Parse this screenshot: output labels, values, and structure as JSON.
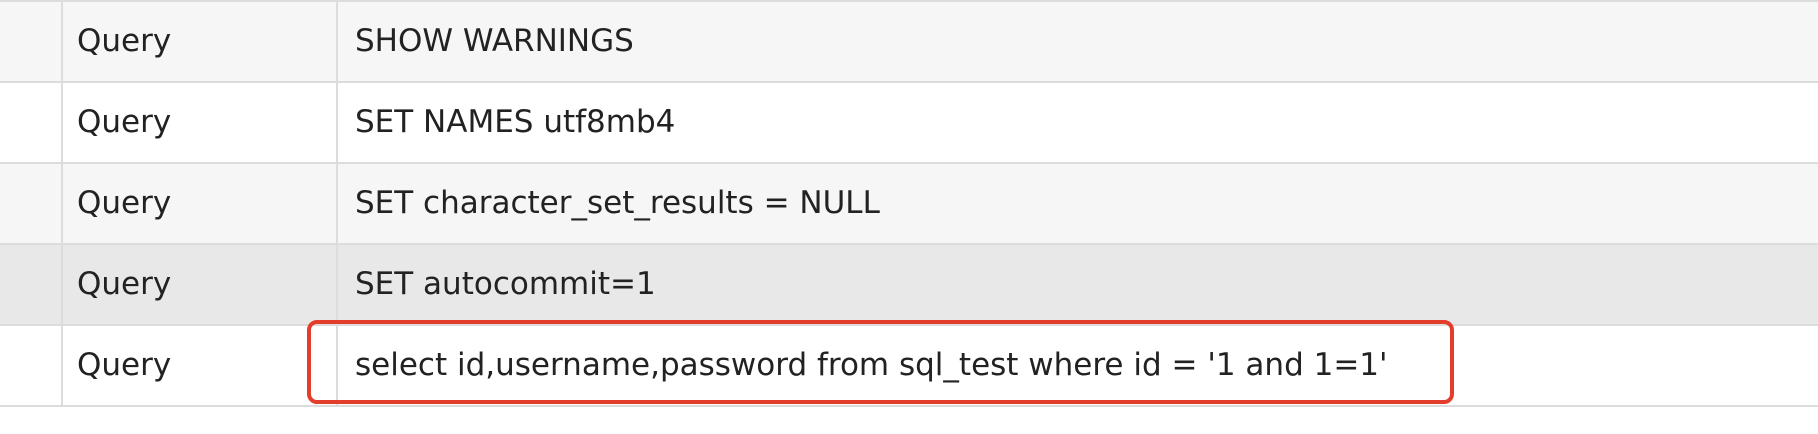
{
  "rows": [
    {
      "command_type": "Query",
      "argument": "SHOW WARNINGS",
      "selected": false
    },
    {
      "command_type": "Query",
      "argument": "SET NAMES utf8mb4",
      "selected": false
    },
    {
      "command_type": "Query",
      "argument": "SET character_set_results = NULL",
      "selected": false
    },
    {
      "command_type": "Query",
      "argument": "SET autocommit=1",
      "selected": true
    },
    {
      "command_type": "Query",
      "argument": "select id,username,password from sql_test where id = '1 and 1=1'",
      "selected": false
    }
  ],
  "colors": {
    "highlight_border": "#e23e2b",
    "row_alt": "#f6f6f6",
    "row_selected": "#e8e8e8",
    "grid_line": "#dcdcdc"
  }
}
